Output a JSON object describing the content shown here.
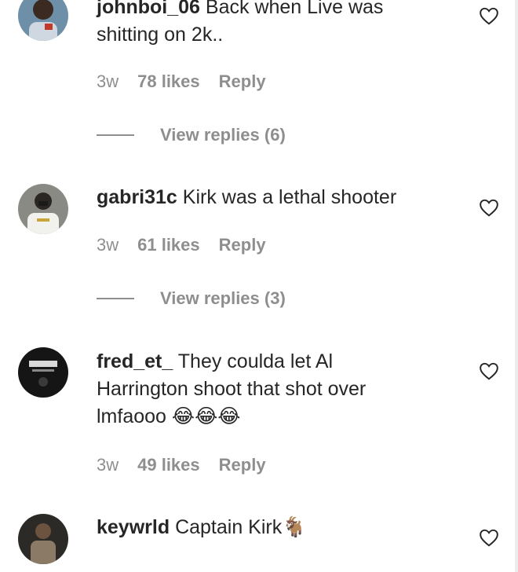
{
  "comments": [
    {
      "username": "johnboi_06",
      "text": "Back when Live was\nshitting on 2k..",
      "time": "3w",
      "likes": "78 likes",
      "reply": "Reply",
      "view_replies": "View replies (6)"
    },
    {
      "username": "gabri31c",
      "text": "Kirk was a lethal shooter",
      "time": "3w",
      "likes": "61 likes",
      "reply": "Reply",
      "view_replies": "View replies (3)"
    },
    {
      "username": "fred_et_",
      "text": "They coulda let Al\nHarrington shoot that shot over\nlmfaooo 😂😂😂",
      "time": "3w",
      "likes": "49 likes",
      "reply": "Reply"
    },
    {
      "username": "keywrld",
      "text": "Captain Kirk🐐"
    }
  ],
  "icons": {
    "like": "heart-outline-icon"
  },
  "colors": {
    "text": "#262626",
    "muted": "#8e8e8e"
  }
}
